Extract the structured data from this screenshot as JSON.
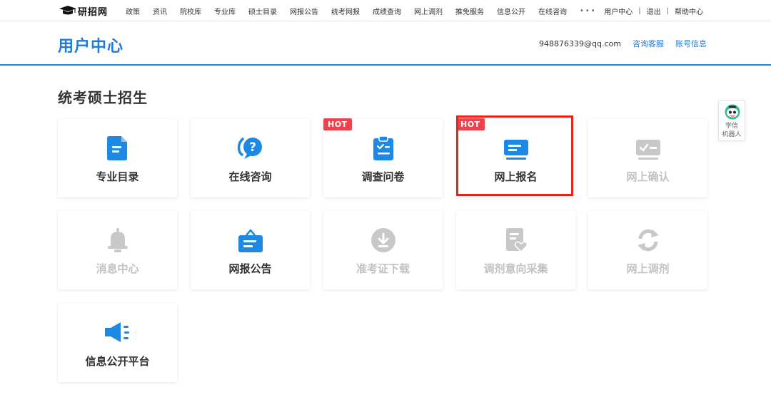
{
  "topbar": {
    "logo_text": "研招网",
    "nav": [
      "政策",
      "资讯",
      "院校库",
      "专业库",
      "硕士目录",
      "网报公告",
      "统考网报",
      "成绩查询",
      "网上调剂",
      "推免服务",
      "信息公开",
      "在线咨询"
    ],
    "more": "•••",
    "right_links": [
      "用户中心",
      "退出",
      "帮助中心"
    ],
    "separator": "|"
  },
  "header": {
    "title": "用户中心",
    "email": "948876339@qq.com",
    "links": [
      "咨询客服",
      "账号信息"
    ]
  },
  "section": {
    "title": "统考硕士招生"
  },
  "cards": [
    {
      "label": "专业目录",
      "icon": "document-icon",
      "enabled": true,
      "hot": false
    },
    {
      "label": "在线咨询",
      "icon": "question-bubble-icon",
      "enabled": true,
      "hot": false
    },
    {
      "label": "调查问卷",
      "icon": "clipboard-check-icon",
      "enabled": true,
      "hot": true
    },
    {
      "label": "网上报名",
      "icon": "id-card-icon",
      "enabled": true,
      "hot": true
    },
    {
      "label": "网上确认",
      "icon": "confirm-card-icon",
      "enabled": false,
      "hot": false
    },
    {
      "label": "消息中心",
      "icon": "bell-icon",
      "enabled": false,
      "hot": false
    },
    {
      "label": "网报公告",
      "icon": "notice-bag-icon",
      "enabled": true,
      "hot": false
    },
    {
      "label": "准考证下载",
      "icon": "download-icon",
      "enabled": false,
      "hot": false
    },
    {
      "label": "调剂意向采集",
      "icon": "heart-document-icon",
      "enabled": false,
      "hot": false
    },
    {
      "label": "网上调剂",
      "icon": "refresh-icon",
      "enabled": false,
      "hot": false
    },
    {
      "label": "信息公开平台",
      "icon": "megaphone-icon",
      "enabled": true,
      "hot": false
    }
  ],
  "hot_label": "HOT",
  "robot": {
    "line1": "学信",
    "line2": "机器人"
  },
  "colors": {
    "brand_blue": "#1f7ad8",
    "icon_blue": "#1e88e5",
    "disabled_gray": "#c8c8c8",
    "hot_red": "#f0414d",
    "highlight_red": "#e8231a"
  }
}
